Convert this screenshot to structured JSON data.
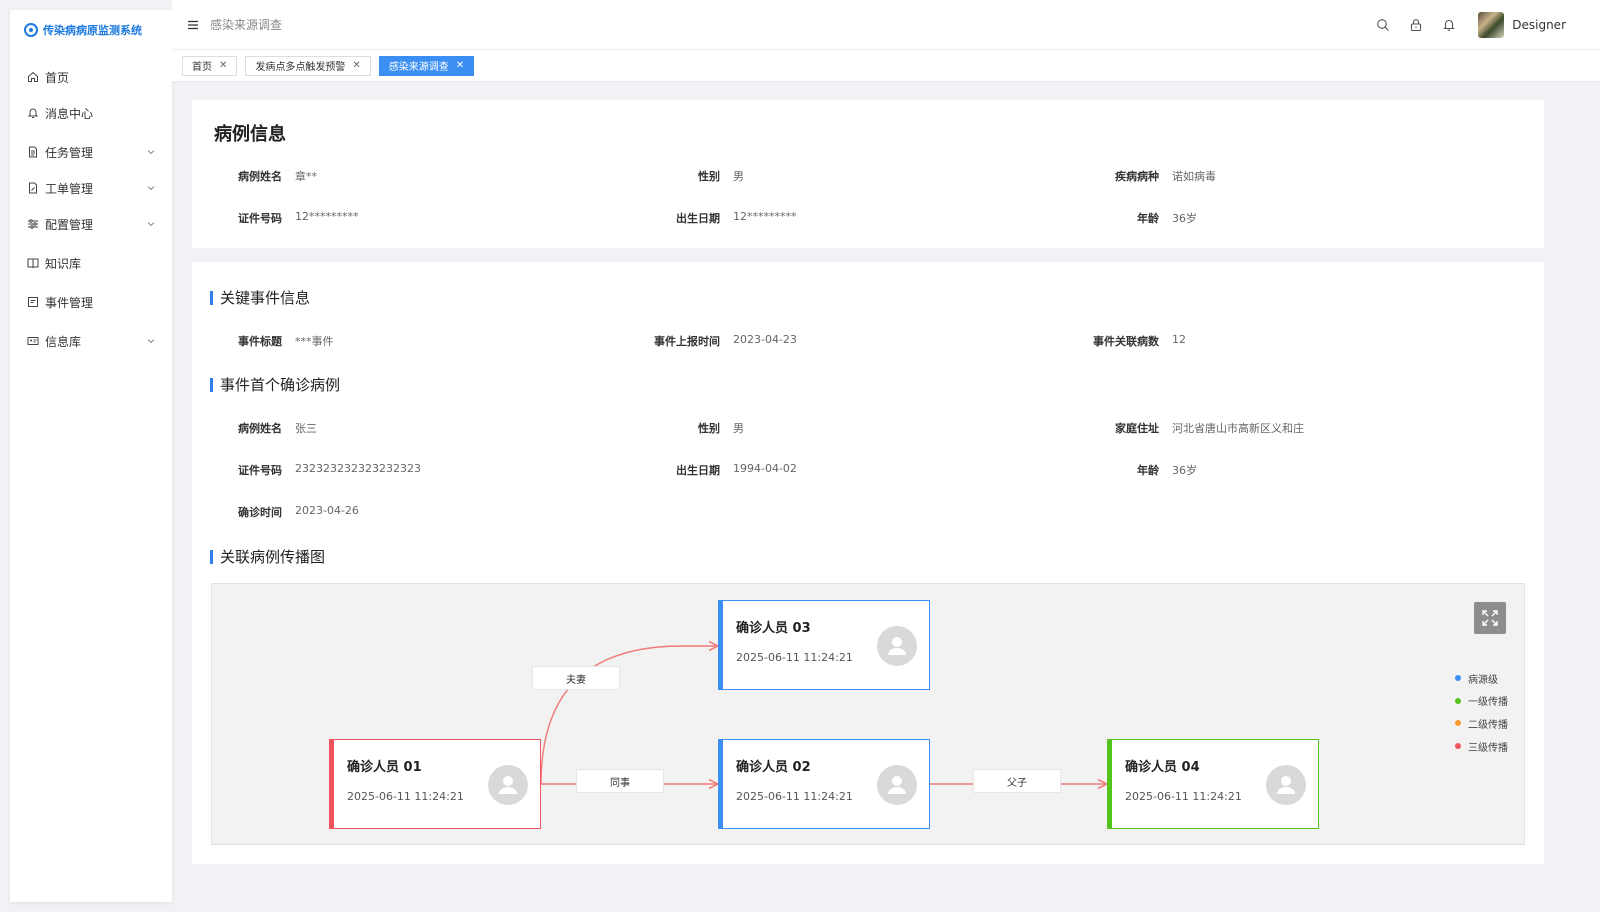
{
  "app": {
    "title": "传染病病原监测系统"
  },
  "sidebar": {
    "items": [
      {
        "label": "首页",
        "icon": "home-icon",
        "expandable": false
      },
      {
        "label": "消息中心",
        "icon": "bell-icon",
        "expandable": false
      },
      {
        "label": "任务管理",
        "icon": "document-icon",
        "expandable": true
      },
      {
        "label": "工单管理",
        "icon": "edit-document-icon",
        "expandable": true
      },
      {
        "label": "配置管理",
        "icon": "sliders-icon",
        "expandable": true
      },
      {
        "label": "知识库",
        "icon": "book-icon",
        "expandable": false
      },
      {
        "label": "事件管理",
        "icon": "calendar-icon",
        "expandable": false
      },
      {
        "label": "信息库",
        "icon": "id-card-icon",
        "expandable": true
      }
    ]
  },
  "header": {
    "breadcrumb": "感染来源调查",
    "user": {
      "name": "Designer"
    }
  },
  "tabs": [
    {
      "label": "首页",
      "active": false
    },
    {
      "label": "发病点多点触发预警",
      "active": false
    },
    {
      "label": "感染来源调查",
      "active": true
    }
  ],
  "case_info": {
    "title": "病例信息",
    "labels": {
      "name": "病例姓名",
      "gender": "性别",
      "disease": "疾病病种",
      "id": "证件号码",
      "birth": "出生日期",
      "age": "年龄"
    },
    "values": {
      "name": "章**",
      "gender": "男",
      "disease": "诺如病毒",
      "id": "12*********",
      "birth": "12*********",
      "age": "36岁"
    }
  },
  "event_info": {
    "title": "关键事件信息",
    "labels": {
      "title": "事件标题",
      "report_time": "事件上报时间",
      "related": "事件关联病数"
    },
    "values": {
      "title": "***事件",
      "report_time": "2023-04-23",
      "related": "12"
    }
  },
  "first_case": {
    "title": "事件首个确诊病例",
    "labels": {
      "name": "病例姓名",
      "gender": "性别",
      "address": "家庭住址",
      "id": "证件号码",
      "birth": "出生日期",
      "age": "年龄",
      "confirm_time": "确诊时间"
    },
    "values": {
      "name": "张三",
      "gender": "男",
      "address": "河北省唐山市高新区义和庄",
      "id": "232323232323232323",
      "birth": "1994-04-02",
      "age": "36岁",
      "confirm_time": "2023-04-26"
    }
  },
  "graph": {
    "title": "关联病例传播图",
    "nodes": [
      {
        "name": "确诊人员 01",
        "time": "2025-06-11 11:24:21",
        "level": "三级传播"
      },
      {
        "name": "确诊人员 03",
        "time": "2025-06-11 11:24:21",
        "level": "病源级"
      },
      {
        "name": "确诊人员 02",
        "time": "2025-06-11 11:24:21",
        "level": "病源级"
      },
      {
        "name": "确诊人员 04",
        "time": "2025-06-11 11:24:21",
        "level": "一级传播"
      }
    ],
    "edges": [
      {
        "from": "确诊人员 01",
        "to": "确诊人员 03",
        "label": "夫妻"
      },
      {
        "from": "确诊人员 01",
        "to": "确诊人员 02",
        "label": "同事"
      },
      {
        "from": "确诊人员 02",
        "to": "确诊人员 04",
        "label": "父子"
      }
    ],
    "legend": [
      {
        "label": "病源级",
        "color": "#3b8ff2"
      },
      {
        "label": "一级传播",
        "color": "#52c41a"
      },
      {
        "label": "二级传播",
        "color": "#fa9a2c"
      },
      {
        "label": "三级传播",
        "color": "#f0545a"
      }
    ],
    "edge_color": "#f07a7a"
  }
}
